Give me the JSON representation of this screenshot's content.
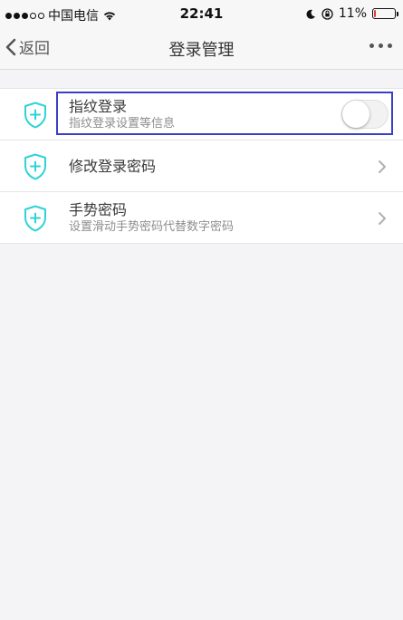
{
  "status_bar": {
    "carrier": "中国电信",
    "time": "22:41",
    "battery_percent": "11%",
    "battery_level": 0.11
  },
  "nav": {
    "back_label": "返回",
    "title": "登录管理"
  },
  "items": [
    {
      "label": "指纹登录",
      "sublabel": "指纹登录设置等信息",
      "toggle_on": false
    },
    {
      "label": "修改登录密码"
    },
    {
      "label": "手势密码",
      "sublabel": "设置滑动手势密码代替数字密码"
    }
  ],
  "colors": {
    "accent_icon": "#2fd3d6",
    "highlight_border": "#3b3fc6"
  },
  "icons": {
    "row_icon": "shield-plus-icon",
    "chevron": "chevron-right-icon",
    "back": "chevron-left-icon"
  }
}
